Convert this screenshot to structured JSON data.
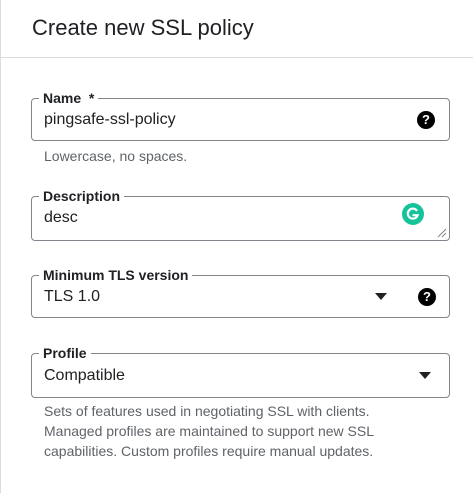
{
  "header": {
    "title": "Create new SSL policy"
  },
  "name_field": {
    "label": "Name",
    "required_mark": "*",
    "value": "pingsafe-ssl-policy",
    "hint": "Lowercase, no spaces.",
    "help_icon": "help-circle-icon"
  },
  "description_field": {
    "label": "Description",
    "value": "desc",
    "extension_icon": "grammarly-icon"
  },
  "tls_field": {
    "label": "Minimum TLS version",
    "selected": "TLS 1.0",
    "dropdown_icon": "dropdown-arrow-icon",
    "help_icon": "help-circle-icon"
  },
  "profile_field": {
    "label": "Profile",
    "selected": "Compatible",
    "dropdown_icon": "dropdown-arrow-icon",
    "hint_lines": [
      "Sets of features used in negotiating SSL with clients.",
      "Managed profiles are maintained to support new SSL",
      "capabilities. Custom profiles require manual updates."
    ]
  },
  "colors": {
    "border": "#80868b",
    "hint_text": "#5f6368",
    "grammarly": "#15c39a"
  }
}
